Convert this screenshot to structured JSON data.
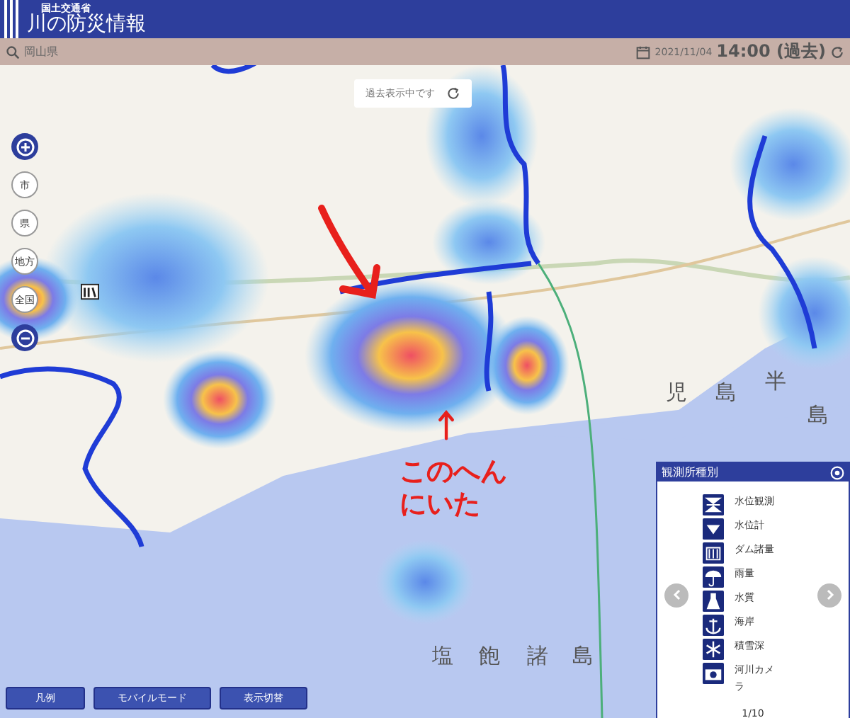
{
  "header": {
    "ministry": "国土交通省",
    "title": "川の防災情報"
  },
  "toolbar": {
    "region": "岡山県",
    "date": "2021/11/04",
    "time": "14:00 (過去)"
  },
  "map": {
    "notice": "過去表示中です",
    "zoom_levels": [
      "市",
      "県",
      "地方",
      "全国"
    ],
    "labels": [
      "児",
      "島",
      "半",
      "島",
      "塩",
      "飽",
      "諸",
      "島"
    ],
    "annotation": [
      "このへん",
      "にいた"
    ]
  },
  "legend": {
    "title": "観測所種別",
    "items": [
      {
        "kind": "level-obs",
        "label": "水位観測"
      },
      {
        "kind": "level-gauge",
        "label": "水位計"
      },
      {
        "kind": "dam",
        "label": "ダム諸量"
      },
      {
        "kind": "rain",
        "label": "雨量"
      },
      {
        "kind": "quality",
        "label": "水質"
      },
      {
        "kind": "coast",
        "label": "海岸"
      },
      {
        "kind": "snow",
        "label": "積雪深"
      },
      {
        "kind": "camera",
        "label": "河川カメラ"
      }
    ],
    "page": "1/10"
  },
  "buttons": [
    "凡例",
    "モバイルモード",
    "表示切替"
  ]
}
